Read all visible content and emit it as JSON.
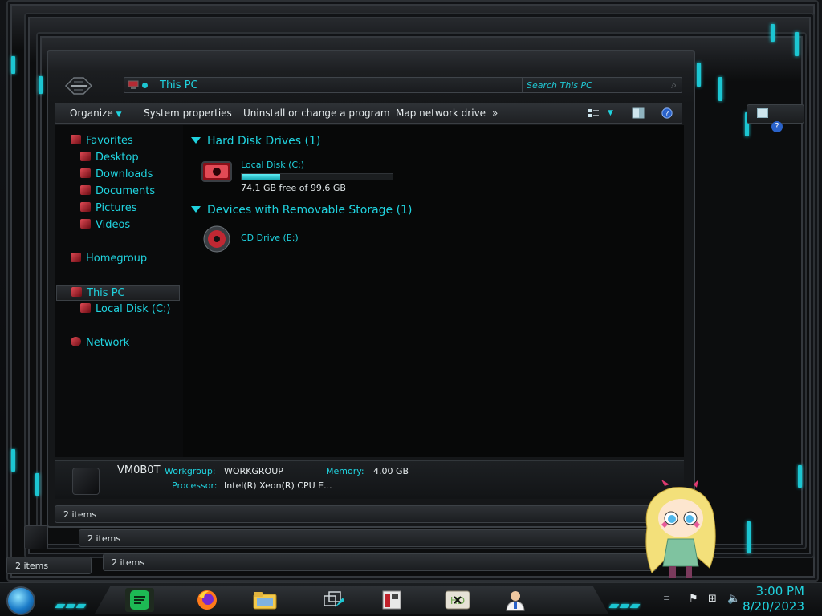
{
  "window": {
    "address": {
      "path": "This PC"
    },
    "search": {
      "placeholder": "Search This PC"
    },
    "toolbar": {
      "organize": "Organize",
      "system_properties": "System properties",
      "uninstall": "Uninstall or change a program",
      "map_drive": "Map network drive",
      "more": "»"
    },
    "nav": {
      "favorites": "Favorites",
      "desktop": "Desktop",
      "downloads": "Downloads",
      "documents": "Documents",
      "pictures": "Pictures",
      "videos": "Videos",
      "homegroup": "Homegroup",
      "this_pc": "This PC",
      "local_disk": "Local Disk (C:)",
      "network": "Network"
    },
    "groups": {
      "hard_disks": "Hard Disk Drives (1)",
      "removable": "Devices with Removable Storage (1)"
    },
    "drives": {
      "c": {
        "name": "Local Disk (C:)",
        "free": "74.1 GB free of 99.6 GB",
        "used_fraction": 0.256
      },
      "e": {
        "name": "CD Drive (E:)"
      }
    },
    "details": {
      "pc_name": "VM0B0T",
      "workgroup_label": "Workgroup:",
      "workgroup": "WORKGROUP",
      "memory_label": "Memory:",
      "memory": "4.00 GB",
      "processor_label": "Processor:",
      "processor": "Intel(R) Xeon(R) CPU E..."
    },
    "status": "2 items"
  },
  "background_windows": {
    "status_1": "2 items",
    "status_2": "2 items",
    "status_3": "2 items"
  },
  "taskbar": {
    "apps": [
      "spotify-like",
      "firefox",
      "file-explorer",
      "task-view",
      "app-5",
      "hd-app",
      "user-app"
    ],
    "time": "3:00 PM",
    "date": "8/20/2023"
  },
  "theme": {
    "accent": "#20d3df",
    "icon_red": "#e14a55"
  }
}
